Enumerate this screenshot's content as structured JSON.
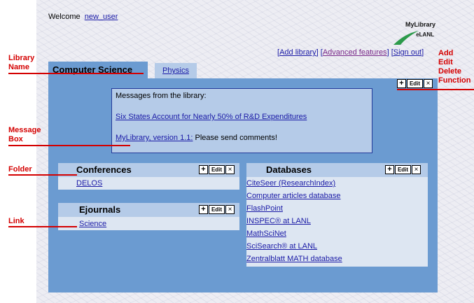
{
  "header": {
    "welcome_text": "Welcome",
    "username": "new_user",
    "logo_line1": "MyLibrary",
    "logo_line2": "eLANL"
  },
  "topnav": {
    "add_library": "Add library",
    "advanced": "Advanced features",
    "signout": "Sign out"
  },
  "tabs": [
    {
      "label": "Computer Science",
      "active": true
    },
    {
      "label": "Physics",
      "active": false
    }
  ],
  "controls": {
    "plus": "+",
    "edit": "Edit",
    "delete": "×"
  },
  "messages": {
    "heading": "Messages from the library:",
    "items": [
      {
        "link": "Six States Account for Nearly 50% of R&D Expenditures",
        "suffix": ""
      },
      {
        "link": "MyLibrary, version 1.1:",
        "suffix": " Please send comments!"
      }
    ]
  },
  "folders": {
    "conferences": {
      "title": "Conferences",
      "links": [
        "DELOS"
      ]
    },
    "ejournals": {
      "title": "Ejournals",
      "links": [
        "Science"
      ]
    },
    "databases": {
      "title": "Databases",
      "links": [
        "CiteSeer (ResearchIndex)",
        "Computer articles database",
        "FlashPoint",
        "INSPEC® at LANL",
        "MathSciNet",
        "SciSearch® at LANL",
        "Zentralblatt MATH database"
      ]
    }
  },
  "annotations": {
    "library_name": [
      "Library",
      "Name"
    ],
    "add_edit_delete": [
      "Add",
      "Edit",
      "Delete",
      "Function"
    ],
    "message_box": [
      "Message",
      "Box"
    ],
    "folder": "Folder",
    "link": "Link"
  },
  "colors": {
    "panel": "#6b9bd1",
    "folder_header": "#b5cbe8",
    "folder_body": "#dde6f2",
    "link": "#1a1aa6",
    "annotation": "#d40000"
  }
}
